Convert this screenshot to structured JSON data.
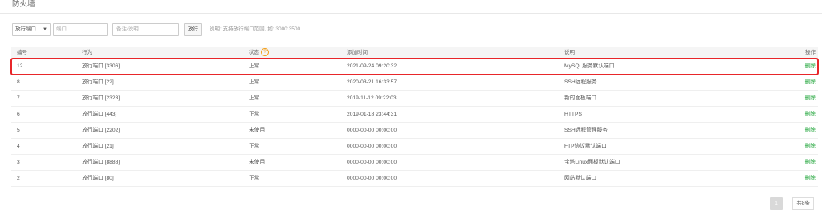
{
  "page": {
    "title": "防火墙"
  },
  "toolbar": {
    "select_value": "放行端口",
    "port_placeholder": "端口",
    "note_placeholder": "备注/说明",
    "submit_label": "放行",
    "help_text": "说明: 支持放行端口范围, 如: 3000:3500"
  },
  "table": {
    "headers": {
      "id": "编号",
      "action": "行为",
      "status": "状态",
      "time": "添加时间",
      "desc": "说明",
      "op": "操作"
    },
    "rows": [
      {
        "id": "12",
        "action": "放行端口:[3306]",
        "status": "正常",
        "time": "2021-09-24 09:20:32",
        "desc": "MySQL服务默认端口",
        "op": "删除"
      },
      {
        "id": "8",
        "action": "放行端口:[22]",
        "status": "正常",
        "time": "2020-03-21 16:33:57",
        "desc": "SSH远程服务",
        "op": "删除"
      },
      {
        "id": "7",
        "action": "放行端口:[2323]",
        "status": "正常",
        "time": "2019-11-12 09:22:03",
        "desc": "新的面板端口",
        "op": "删除"
      },
      {
        "id": "6",
        "action": "放行端口:[443]",
        "status": "正常",
        "time": "2019-01-18 23:44:31",
        "desc": "HTTPS",
        "op": "删除"
      },
      {
        "id": "5",
        "action": "放行端口:[2202]",
        "status": "未使用",
        "time": "0000-00-00 00:00:00",
        "desc": "SSH远程管理服务",
        "op": "删除"
      },
      {
        "id": "4",
        "action": "放行端口:[21]",
        "status": "正常",
        "time": "0000-00-00 00:00:00",
        "desc": "FTP协议默认端口",
        "op": "删除"
      },
      {
        "id": "3",
        "action": "放行端口:[8888]",
        "status": "未使用",
        "time": "0000-00-00 00:00:00",
        "desc": "宝塔Linux面板默认端口",
        "op": "删除"
      },
      {
        "id": "2",
        "action": "放行端口:[80]",
        "status": "正常",
        "time": "0000-00-00 00:00:00",
        "desc": "网站默认端口",
        "op": "删除"
      }
    ]
  },
  "pagination": {
    "current": "1",
    "total_text": "共8条"
  },
  "colors": {
    "accent_green": "#20a53a",
    "highlight_red": "#e8262a",
    "help_orange": "#f39c12"
  }
}
